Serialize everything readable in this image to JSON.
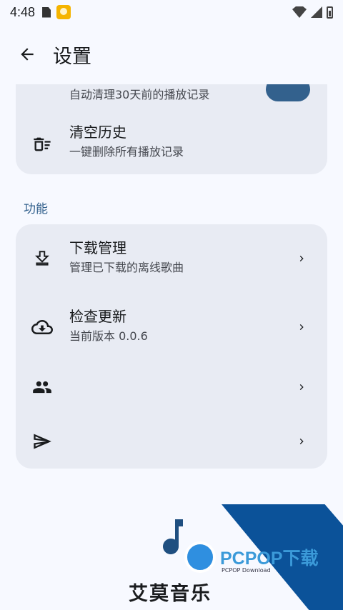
{
  "status_bar": {
    "time": "4:48"
  },
  "app_bar": {
    "title": "设置"
  },
  "history_card": {
    "partial_subtitle": "自动清理30天前的播放记录",
    "clear_history": {
      "title": "清空历史",
      "subtitle": "一键删除所有播放记录"
    }
  },
  "features_section": {
    "label": "功能",
    "items": [
      {
        "title": "下载管理",
        "subtitle": "管理已下载的离线歌曲",
        "icon": "download-icon"
      },
      {
        "title": "检查更新",
        "subtitle": "当前版本 0.0.6",
        "icon": "cloud-download-icon"
      },
      {
        "title": "",
        "subtitle": "",
        "icon": "people-icon"
      },
      {
        "title": "",
        "subtitle": "",
        "icon": "send-icon"
      }
    ]
  },
  "branding": {
    "app_name": "艾莫音乐"
  },
  "watermark": {
    "brand": "PCPOP下载",
    "sub": "PCPOP Download"
  },
  "colors": {
    "accent": "#33618d",
    "card_bg": "#e8ebf3",
    "page_bg": "#f7f9ff"
  }
}
